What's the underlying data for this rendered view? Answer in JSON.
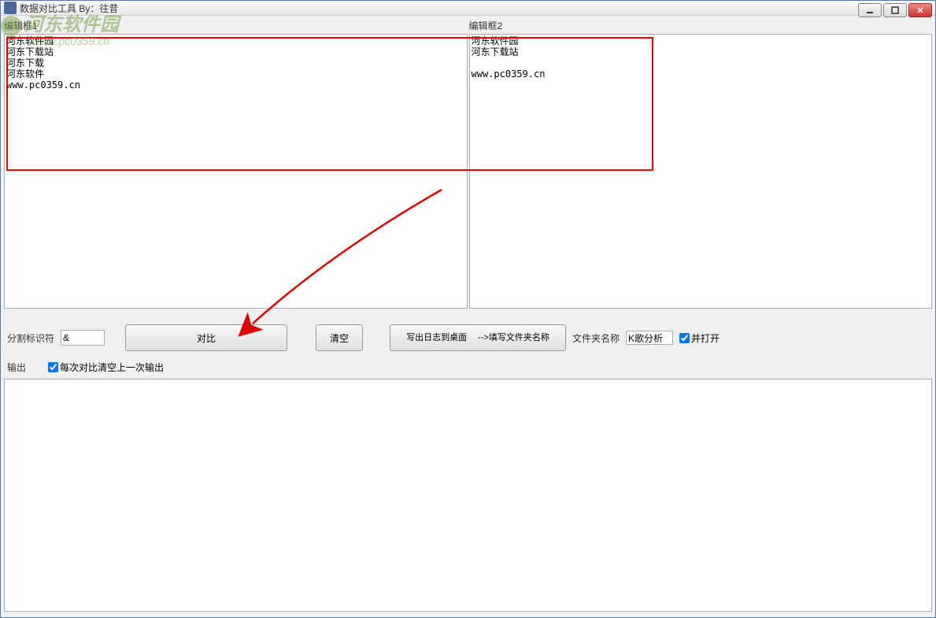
{
  "window": {
    "title": "数据对比工具  By：往昔"
  },
  "editors": {
    "label1": "编辑框1",
    "label2": "编辑框2",
    "content1": "河东软件园\n河东下载站\n河东下载\n河东软件\nwww.pc0359.cn",
    "content2": "河东软件园\n河东下载站\n\nwww.pc0359.cn"
  },
  "controls": {
    "delimiter_label": "分割标识符",
    "delimiter_value": "&",
    "compare_btn": "对比",
    "clear_btn": "清空",
    "log_btn": "写出日志到桌面　 -->填写文件夹名称",
    "folder_label": "文件夹名称",
    "folder_value": "K歌分析",
    "open_checkbox": "并打开"
  },
  "output": {
    "label": "输出",
    "clear_checkbox": "每次对比清空上一次输出",
    "content": ""
  },
  "watermark": {
    "text": "河东软件园",
    "url": "www.pc0359.cn"
  }
}
